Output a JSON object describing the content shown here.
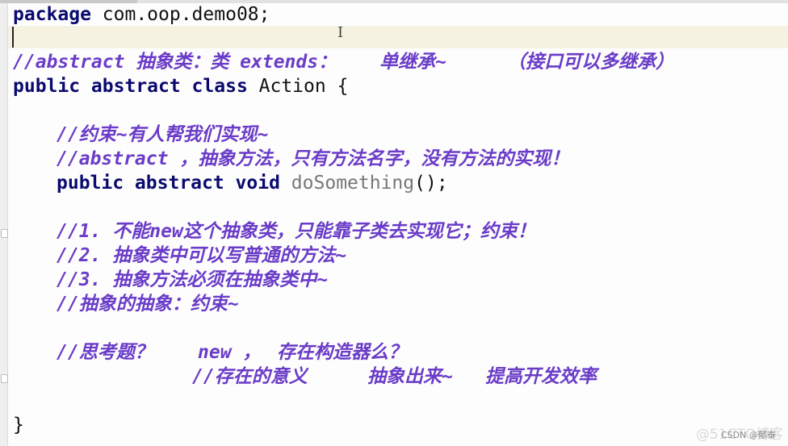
{
  "editor": {
    "language": "java",
    "colors": {
      "keyword": "#0a0a6e",
      "comment": "#6a3cc8",
      "method": "#777777",
      "current_line": "#f6f2e2"
    },
    "lines": {
      "l1": {
        "kw": "package",
        "rest": " com.oop.demo08;"
      },
      "l3": {
        "a": "//abstract 抽象类：类 extends：",
        "b": "单继承~",
        "c": "（接口可以多继承）"
      },
      "l4": {
        "kw": "public abstract class",
        "rest": " Action {"
      },
      "l6": "//约束~有人帮我们实现~",
      "l7": "//abstract ，抽象方法，只有方法名字，没有方法的实现！",
      "l8": {
        "kw": "public abstract void",
        "fn": " doSomething",
        "rest": "();"
      },
      "l10": "//1. 不能new这个抽象类，只能靠子类去实现它；约束！",
      "l11": "//2. 抽象类中可以写普通的方法~",
      "l12": "//3. 抽象方法必须在抽象类中~",
      "l13": "//抽象的抽象：约束~",
      "l15": {
        "a": "//思考题？",
        "b": "new ，",
        "c": "存在构造器么？"
      },
      "l16": {
        "a": "//存在的意义",
        "b": "抽象出来~",
        "c": "提高开发效率"
      },
      "l18": "}"
    }
  },
  "watermark": {
    "primary": "@51CTO博客",
    "secondary": "CSDN @郁泰"
  }
}
